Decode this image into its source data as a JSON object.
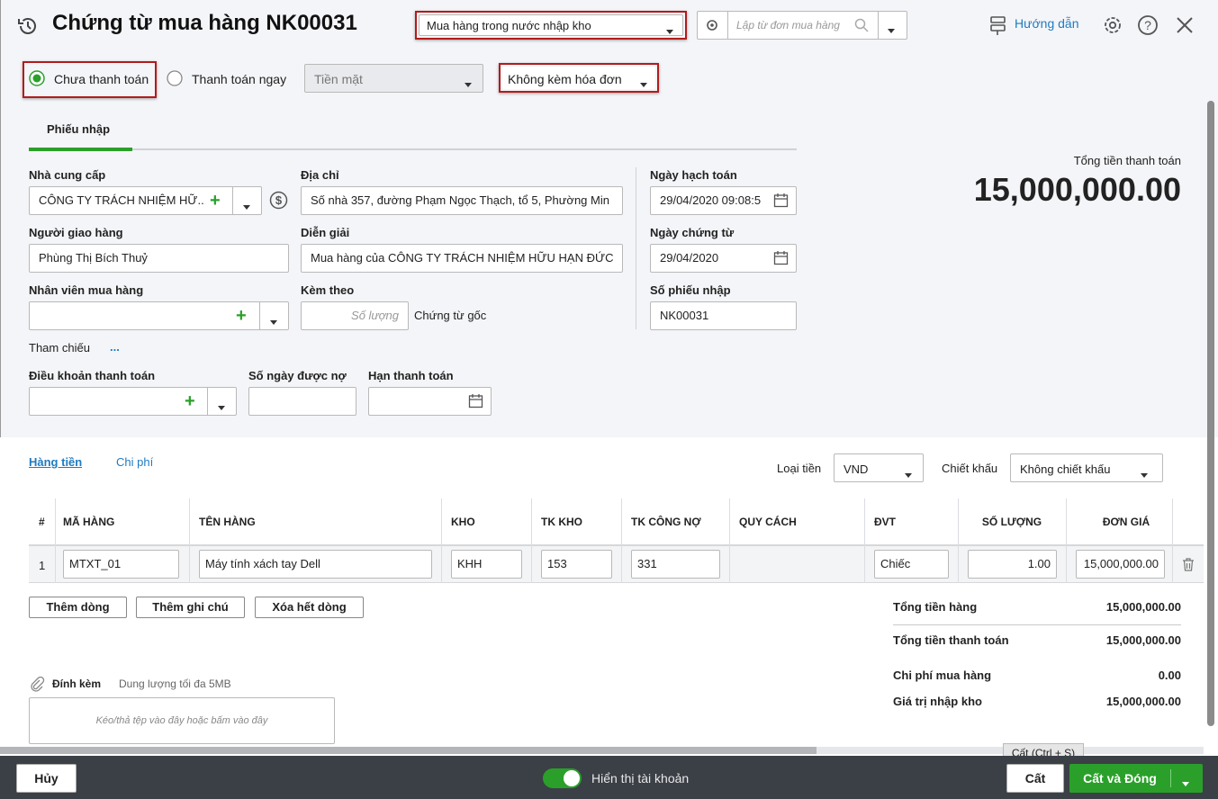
{
  "header": {
    "title": "Chứng từ mua hàng NK00031",
    "type_select": "Mua hàng trong nước nhập kho",
    "search_placeholder": "Lập từ đơn mua hàng",
    "guide": "Hướng dẫn"
  },
  "payment": {
    "unpaid": "Chưa thanh toán",
    "pay_now": "Thanh toán ngay",
    "method": "Tiền mặt",
    "invoice": "Không kèm hóa đơn"
  },
  "tabs": {
    "receipt": "Phiếu nhập"
  },
  "total": {
    "label": "Tổng tiền thanh toán",
    "value": "15,000,000.00"
  },
  "form": {
    "supplier_label": "Nhà cung cấp",
    "supplier_value": "CÔNG TY TRÁCH NHIỆM HỮ...",
    "address_label": "Địa chỉ",
    "address_value": "Số nhà 357, đường Phạm Ngọc Thạch, tổ 5, Phường Min",
    "posting_date_label": "Ngày hạch toán",
    "posting_date_value": "29/04/2020 09:08:5",
    "deliverer_label": "Người giao hàng",
    "deliverer_value": "Phùng Thị Bích Thuỷ",
    "description_label": "Diễn giải",
    "description_value": "Mua hàng của CÔNG TY TRÁCH NHIỆM HỮU HẠN  ĐỨC",
    "voucher_date_label": "Ngày chứng từ",
    "voucher_date_value": "29/04/2020",
    "buyer_label": "Nhân viên mua hàng",
    "attach_label": "Kèm theo",
    "attach_placeholder": "Số lượng",
    "original_docs": "Chứng từ gốc",
    "receipt_no_label": "Số phiếu nhập",
    "receipt_no_value": "NK00031",
    "reference": "Tham chiếu",
    "reference_more": "...",
    "terms_label": "Điều khoản thanh toán",
    "debt_days_label": "Số ngày được nợ",
    "due_label": "Hạn thanh toán"
  },
  "detail_tabs": {
    "goods": "Hàng tiền",
    "cost": "Chi phí"
  },
  "currency": {
    "label": "Loại tiền",
    "value": "VND"
  },
  "discount": {
    "label": "Chiết khấu",
    "value": "Không chiết khấu"
  },
  "table": {
    "headers": [
      "#",
      "MÃ HÀNG",
      "TÊN HÀNG",
      "KHO",
      "TK KHO",
      "TK CÔNG NỢ",
      "QUY CÁCH",
      "ĐVT",
      "SỐ LƯỢNG",
      "ĐƠN GIÁ"
    ],
    "rows": [
      {
        "no": "1",
        "code": "MTXT_01",
        "name": "Máy tính xách tay Dell",
        "warehouse": "KHH",
        "stock_acc": "153",
        "debt_acc": "331",
        "spec": "",
        "unit": "Chiếc",
        "qty": "1.00",
        "price": "15,000,000.00"
      }
    ]
  },
  "actions": {
    "add_row": "Thêm dòng",
    "add_note": "Thêm ghi chú",
    "delete_all": "Xóa hết dòng"
  },
  "summary": {
    "goods_total_label": "Tổng tiền hàng",
    "goods_total": "15,000,000.00",
    "pay_total_label": "Tổng tiền thanh toán",
    "pay_total": "15,000,000.00",
    "purchase_cost_label": "Chi phí mua hàng",
    "purchase_cost": "0.00",
    "stock_value_label": "Giá trị nhập kho",
    "stock_value": "15,000,000.00"
  },
  "attachment": {
    "label": "Đính kèm",
    "limit": "Dung lượng tối đa 5MB",
    "drop": "Kéo/thả tệp vào đây hoặc bấm vào đây"
  },
  "footer": {
    "cancel": "Hủy",
    "show_account": "Hiển thị tài khoản",
    "tooltip": "Cất (Ctrl + S)",
    "save": "Cất",
    "save_close": "Cất và Đóng"
  }
}
